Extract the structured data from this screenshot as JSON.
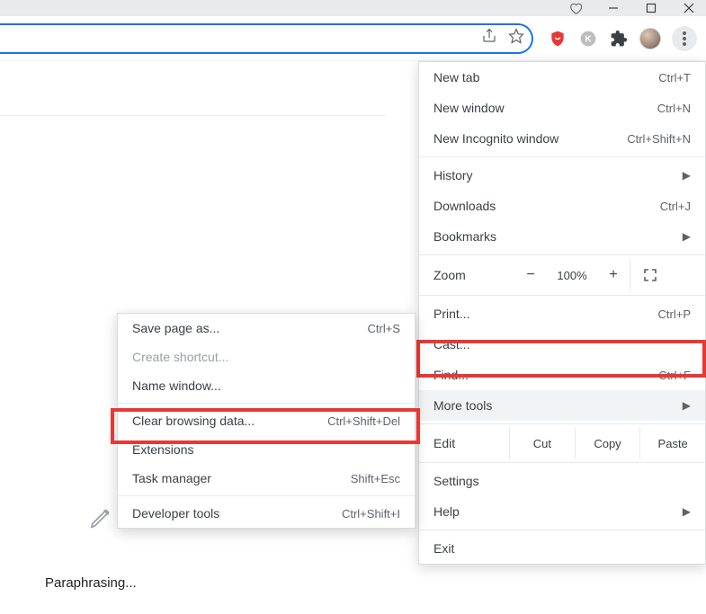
{
  "window_controls": {
    "heart": "♡",
    "minimize": "—",
    "maximize": "▢",
    "close": "✕"
  },
  "toolbar": {
    "share_icon": "share-icon",
    "star_icon": "star-icon",
    "ublock_icon": "ublock-icon",
    "k_ext_icon": "k-extension-icon",
    "puzzle_icon": "extensions-icon",
    "avatar_icon": "profile-avatar",
    "kebab_icon": "menu-icon"
  },
  "menu": {
    "new_tab": {
      "label": "New tab",
      "shortcut": "Ctrl+T"
    },
    "new_window": {
      "label": "New window",
      "shortcut": "Ctrl+N"
    },
    "incognito": {
      "label": "New Incognito window",
      "shortcut": "Ctrl+Shift+N"
    },
    "history": {
      "label": "History"
    },
    "downloads": {
      "label": "Downloads",
      "shortcut": "Ctrl+J"
    },
    "bookmarks": {
      "label": "Bookmarks"
    },
    "zoom": {
      "label": "Zoom",
      "minus": "−",
      "value": "100%",
      "plus": "+"
    },
    "print": {
      "label": "Print...",
      "shortcut": "Ctrl+P"
    },
    "cast": {
      "label": "Cast..."
    },
    "find": {
      "label": "Find...",
      "shortcut": "Ctrl+F"
    },
    "more_tools": {
      "label": "More tools"
    },
    "edit": {
      "label": "Edit",
      "cut": "Cut",
      "copy": "Copy",
      "paste": "Paste"
    },
    "settings": {
      "label": "Settings"
    },
    "help": {
      "label": "Help"
    },
    "exit": {
      "label": "Exit"
    }
  },
  "submenu": {
    "save_page": {
      "label": "Save page as...",
      "shortcut": "Ctrl+S"
    },
    "create_shortcut": {
      "label": "Create shortcut..."
    },
    "name_window": {
      "label": "Name window..."
    },
    "clear_browsing": {
      "label": "Clear browsing data...",
      "shortcut": "Ctrl+Shift+Del"
    },
    "extensions": {
      "label": "Extensions"
    },
    "task_manager": {
      "label": "Task manager",
      "shortcut": "Shift+Esc"
    },
    "developer_tools": {
      "label": "Developer tools",
      "shortcut": "Ctrl+Shift+I"
    }
  },
  "page": {
    "status_text": "Paraphrasing..."
  }
}
